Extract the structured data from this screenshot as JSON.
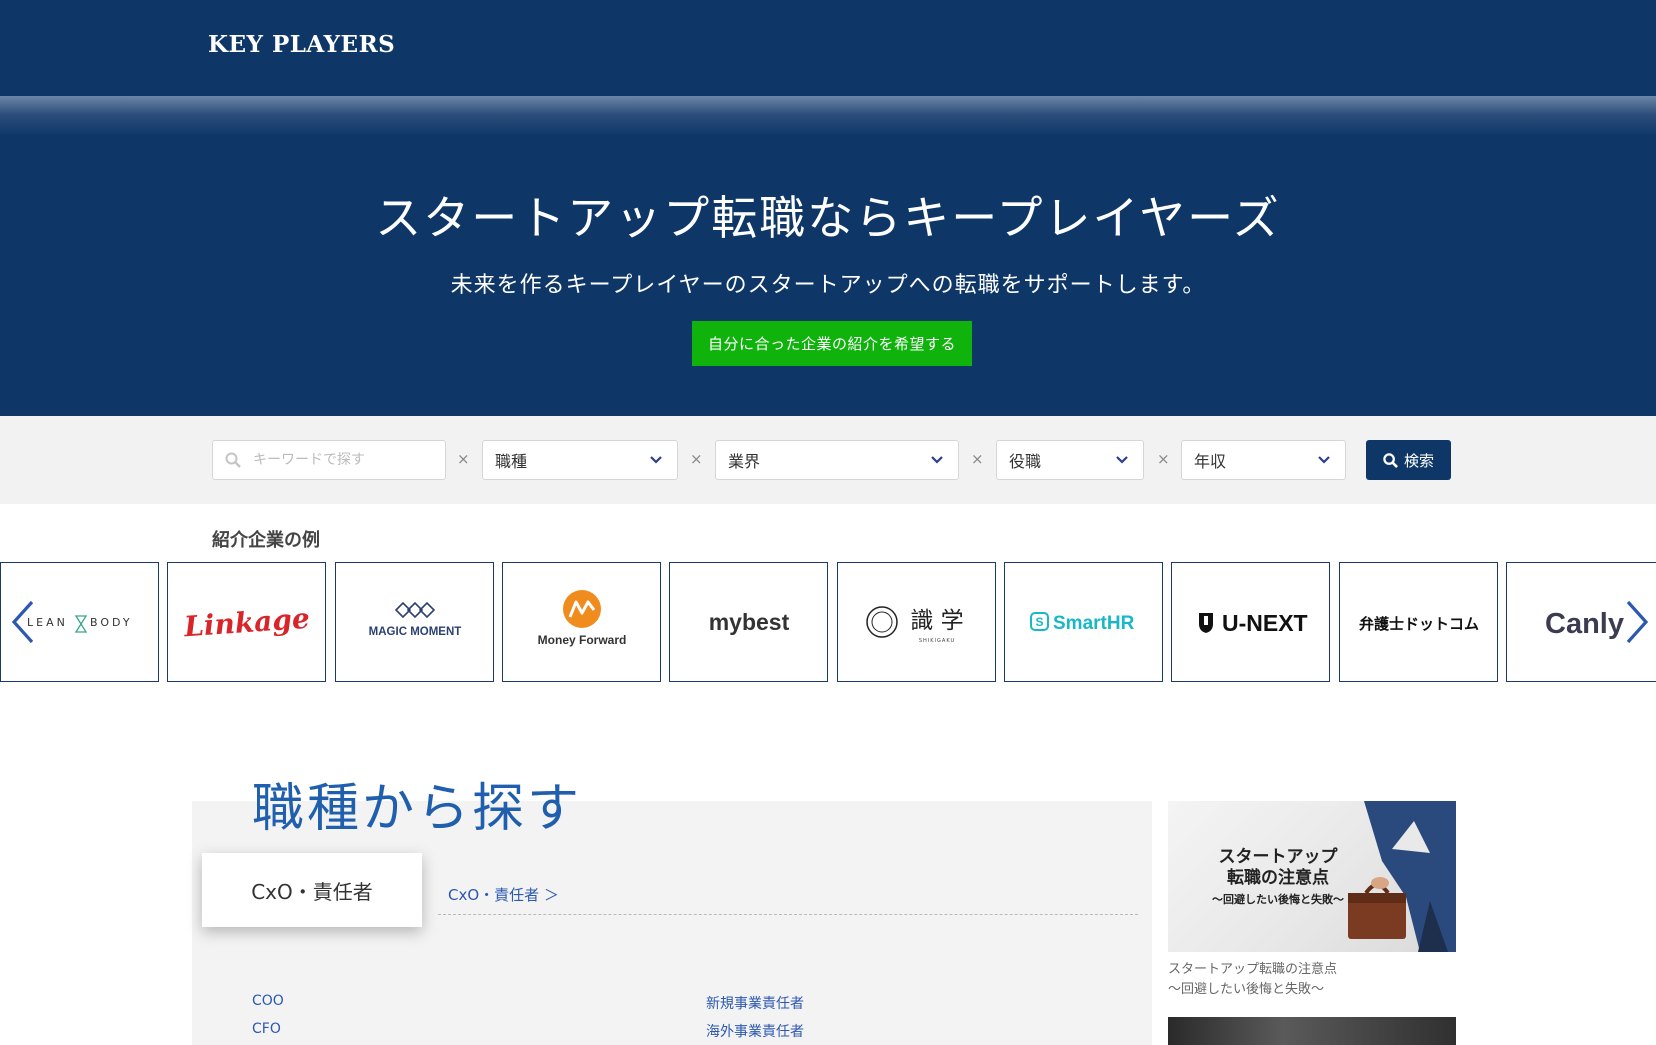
{
  "header": {
    "logo": "KEY PLAYERS"
  },
  "hero": {
    "title": "スタートアップ転職ならキープレイヤーズ",
    "subtitle": "未来を作るキープレイヤーのスタートアップへの転職をサポートします。",
    "cta_label": "自分に合った企業の紹介を希望する"
  },
  "search": {
    "keyword_placeholder": "キーワードで探す",
    "separator": "×",
    "job_type": "職種",
    "industry": "業界",
    "position": "役職",
    "salary": "年収",
    "button_label": "検索"
  },
  "companies": {
    "label": "紹介企業の例",
    "logos": [
      "LEAN",
      "BODY",
      "Linkage",
      "MAGIC MOMENT",
      "Money Forward",
      "mybest",
      "識 学",
      "SHIKIGAKU",
      "SmartHR",
      "U-NEXT",
      "弁護士ドットコム",
      "Canly"
    ]
  },
  "jobs": {
    "title": "職種から探す",
    "active_tab": "CxO・責任者",
    "category_link": "CxO・責任者 ＞",
    "links": [
      "COO",
      "CFO",
      "新規事業責任者",
      "海外事業責任者"
    ]
  },
  "article": {
    "image_title_1": "スタートアップ",
    "image_title_2": "転職の注意点",
    "image_subtitle": "〜回避したい後悔と失敗〜",
    "caption_1": "スタートアップ転職の注意点",
    "caption_2": "〜回避したい後悔と失敗〜"
  },
  "colors": {
    "navy": "#0e3768",
    "cta_green": "#0fb30c",
    "link_blue": "#2c58b0",
    "title_blue": "#1f5fae",
    "smarthr_teal": "#18b8c6",
    "linkage_red": "#d9252a",
    "money_forward_orange": "#f08c1e"
  }
}
